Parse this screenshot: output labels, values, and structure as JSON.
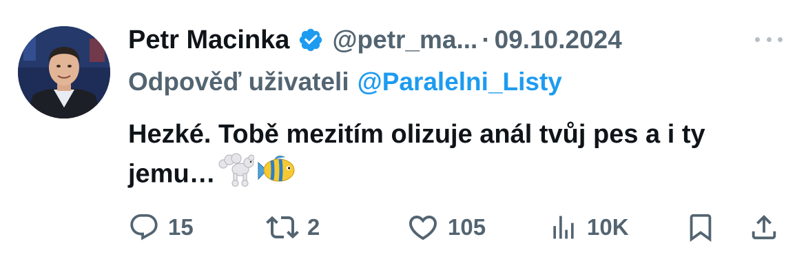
{
  "tweet": {
    "author_name": "Petr Macinka",
    "handle": "@petr_ma...",
    "separator": "·",
    "date": "09.10.2024",
    "reply_prefix": "Odpověď uživateli",
    "reply_to": "@Paralelni_Listy",
    "text": "Hezké. Tobě mezitím olizuje anál tvůj pes a i ty jemu…",
    "emojis": [
      "poodle",
      "tropical-fish"
    ]
  },
  "actions": {
    "reply_count": "15",
    "retweet_count": "2",
    "like_count": "105",
    "views_count": "10K"
  },
  "colors": {
    "text": "#0f1419",
    "secondary": "#536471",
    "accent": "#1d9bf0"
  },
  "icons": [
    "verified-badge-icon",
    "more-icon",
    "reply-icon",
    "retweet-icon",
    "like-icon",
    "views-icon",
    "bookmark-icon",
    "share-icon"
  ]
}
